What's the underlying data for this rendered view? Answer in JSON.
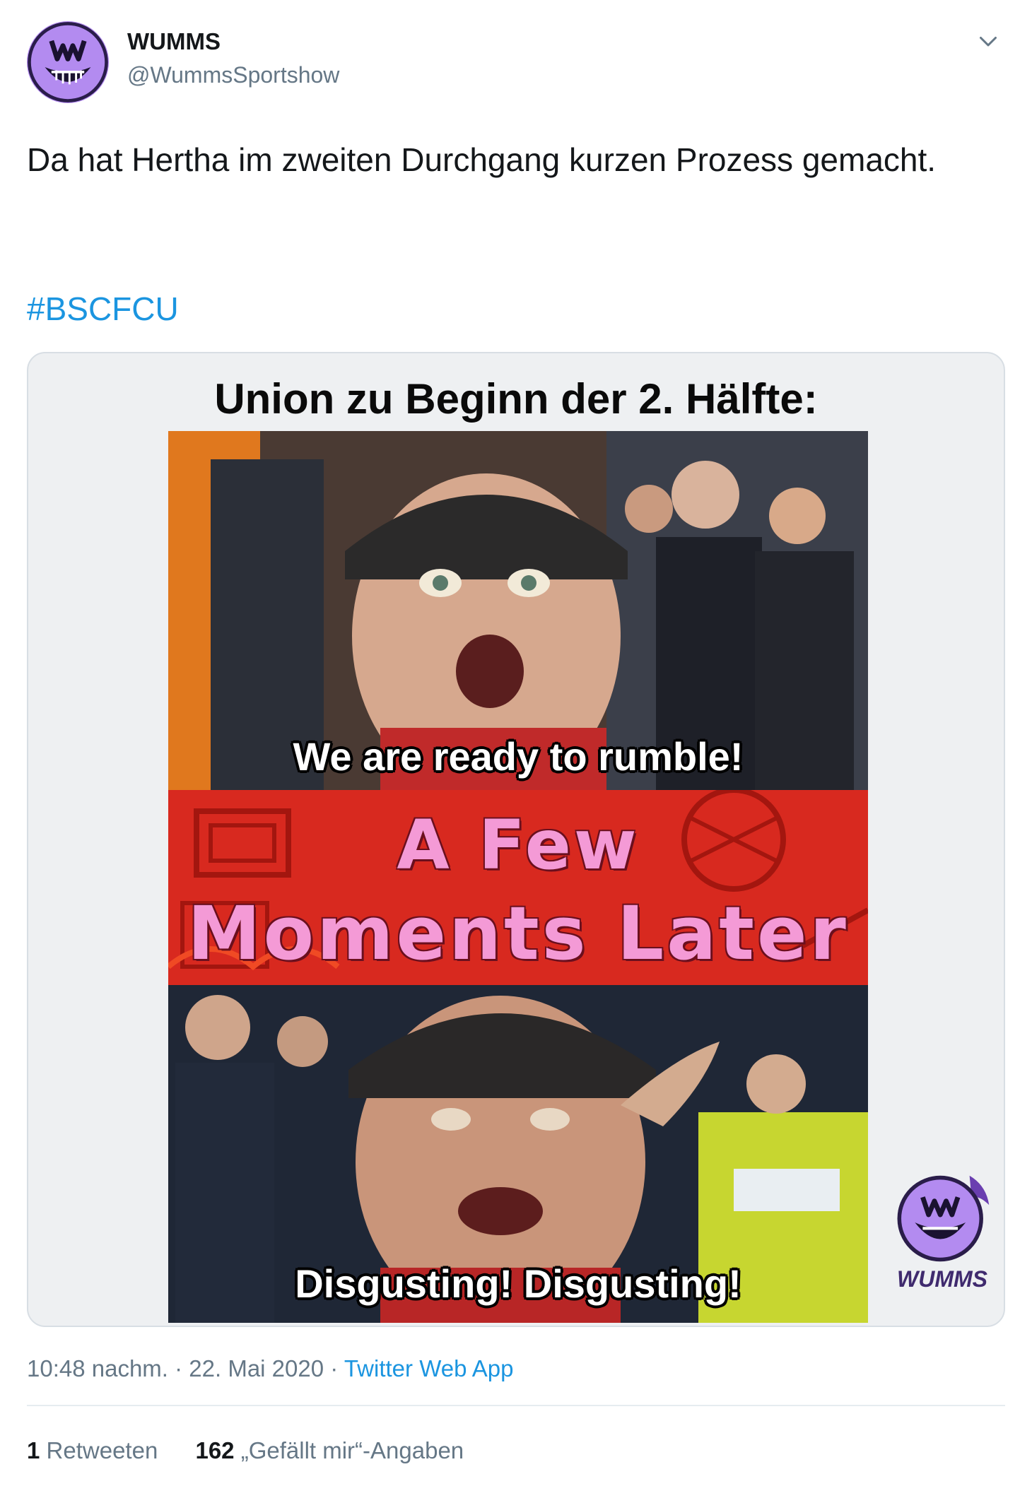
{
  "author": {
    "display_name": "WUMMS",
    "handle": "@WummsSportshow",
    "avatar_icon": "wumms-grin-logo-icon",
    "avatar_color": "#b38bf0"
  },
  "tweet": {
    "text": "Da hat Hertha im zweiten Durchgang kurzen Prozess gemacht.",
    "hashtag": "#BSCFCU"
  },
  "meme": {
    "title": "Union zu Beginn der 2. Hälfte:",
    "top_caption": "We are ready to rumble!",
    "middle_line_1": "A Few",
    "middle_line_2": "Moments Later",
    "bottom_caption": "Disgusting! Disgusting!",
    "watermark_text": "WUMMS"
  },
  "meta": {
    "time": "10:48 nachm.",
    "separator": " · ",
    "date": "22. Mai 2020",
    "source": "Twitter Web App"
  },
  "stats": {
    "retweets_count": "1",
    "retweets_label": "Retweeten",
    "likes_count": "162",
    "likes_label": "„Gefällt mir“-Angaben"
  },
  "colors": {
    "link": "#1b95e0",
    "secondary_text": "#657786",
    "accent_purple": "#b38bf0"
  }
}
